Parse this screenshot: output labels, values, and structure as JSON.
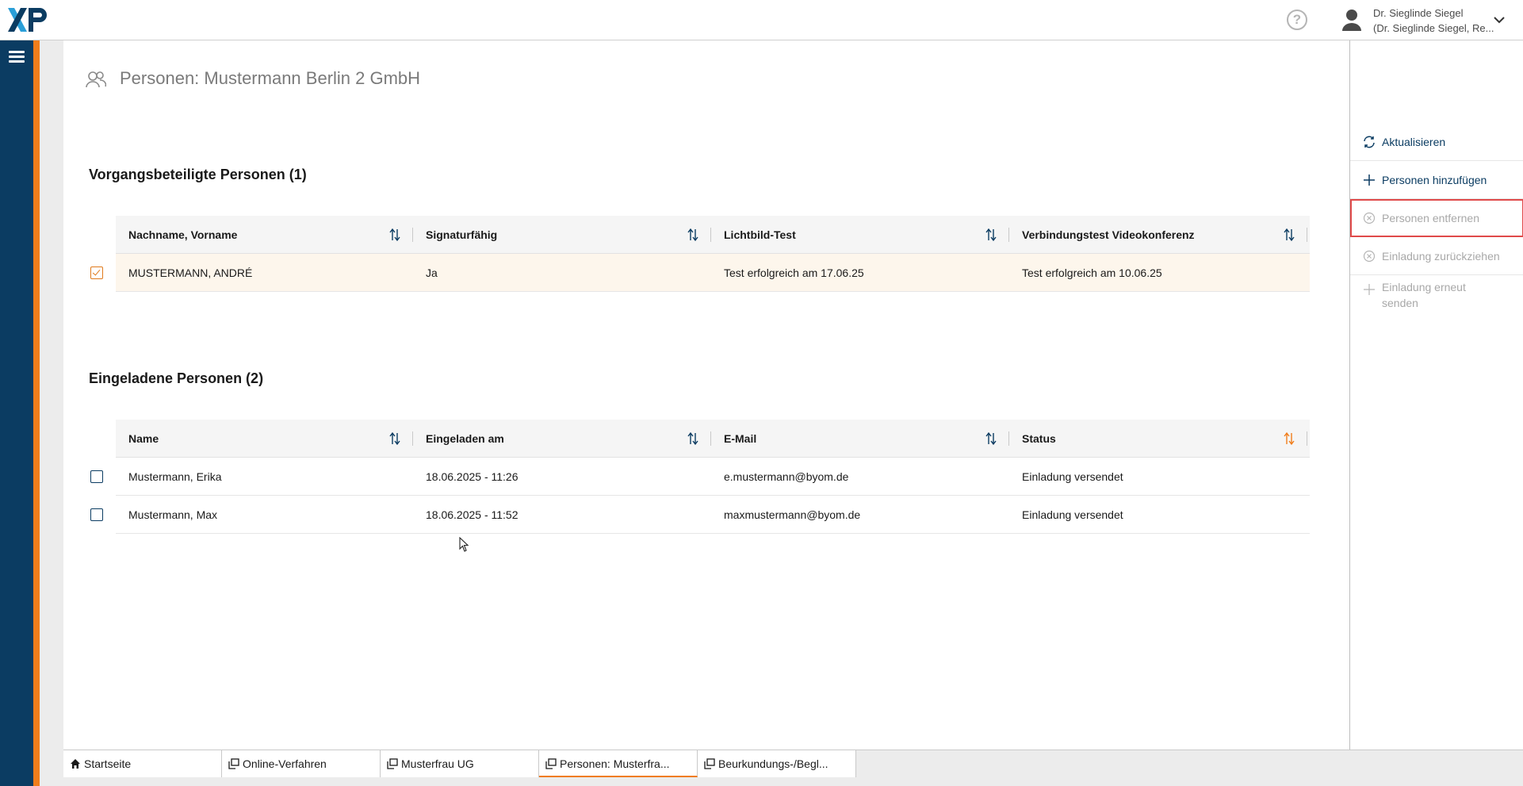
{
  "header": {
    "logo_text": "XP",
    "user_name": "Dr. Sieglinde Siegel",
    "user_role": "(Dr. Sieglinde Siegel, Re..."
  },
  "page": {
    "title": "Personen: Mustermann Berlin 2 GmbH"
  },
  "participants": {
    "title": "Vorgangsbeteiligte Personen (1)",
    "columns": [
      "Nachname, Vorname",
      "Signaturfähig",
      "Lichtbild-Test",
      "Verbindungstest Videokonferenz"
    ],
    "rows": [
      {
        "checked": true,
        "cells": [
          "MUSTERMANN, ANDRÉ",
          "Ja",
          "Test erfolgreich am 17.06.25",
          "Test erfolgreich am 10.06.25"
        ]
      }
    ]
  },
  "invited": {
    "title": "Eingeladene Personen (2)",
    "columns": [
      "Name",
      "Eingeladen am",
      "E-Mail",
      "Status"
    ],
    "rows": [
      {
        "checked": false,
        "cells": [
          "Mustermann, Erika",
          "18.06.2025 - 11:26",
          "e.mustermann@byom.de",
          "Einladung versendet"
        ]
      },
      {
        "checked": false,
        "cells": [
          "Mustermann, Max",
          "18.06.2025 - 11:52",
          "maxmustermann@byom.de",
          "Einladung versendet"
        ]
      }
    ]
  },
  "actions": [
    {
      "label": "Aktualisieren",
      "icon": "refresh-icon",
      "enabled": true
    },
    {
      "label": "Personen hinzufügen",
      "icon": "plus-icon",
      "enabled": true
    },
    {
      "label": "Personen entfernen",
      "icon": "remove-circle-icon",
      "enabled": false
    },
    {
      "label": "Einladung zurückziehen",
      "icon": "remove-circle-icon",
      "enabled": false
    },
    {
      "label": "Einladung erneut senden",
      "icon": "plus-icon",
      "enabled": false
    }
  ],
  "tabs": [
    {
      "label": "Startseite",
      "icon": "home-icon",
      "active": false
    },
    {
      "label": "Online-Verfahren",
      "icon": "window-icon",
      "active": false
    },
    {
      "label": "Musterfrau UG",
      "icon": "window-icon",
      "active": false
    },
    {
      "label": "Personen: Musterfra...",
      "icon": "window-icon",
      "active": true
    },
    {
      "label": "Beurkundungs-/Begl...",
      "icon": "window-icon",
      "active": false
    }
  ],
  "colors": {
    "nav": "#0b3c62",
    "accent": "#f07d1b",
    "highlight": "#e04a4a",
    "disabled": "#a8a8a8"
  }
}
